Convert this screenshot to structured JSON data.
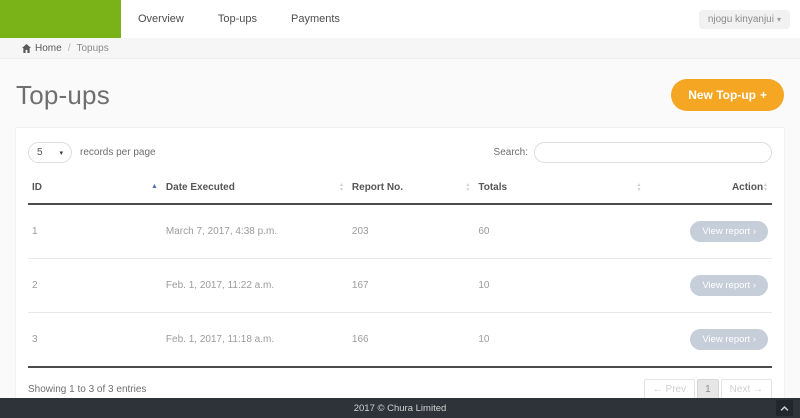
{
  "navbar": {
    "items": [
      {
        "label": "Overview"
      },
      {
        "label": "Top-ups"
      },
      {
        "label": "Payments"
      }
    ],
    "user_menu": {
      "label": "njogu kinyanjui"
    }
  },
  "breadcrumb": {
    "home": "Home",
    "separator": "/",
    "current": "Topups"
  },
  "page": {
    "title": "Top-ups",
    "new_topup": {
      "label": "New Top-up",
      "icon": "+"
    }
  },
  "controls": {
    "page_size": "5",
    "records_label": "records per page",
    "search_label": "Search:",
    "search_value": ""
  },
  "table": {
    "columns": [
      {
        "label": "ID"
      },
      {
        "label": "Date Executed"
      },
      {
        "label": "Report No."
      },
      {
        "label": "Totals"
      },
      {
        "label": "Action"
      }
    ],
    "rows": [
      {
        "id": "1",
        "date": "March 7, 2017, 4:38 p.m.",
        "report_no": "203",
        "totals": "60",
        "action": "View report ›"
      },
      {
        "id": "2",
        "date": "Feb. 1, 2017, 11:22 a.m.",
        "report_no": "167",
        "totals": "10",
        "action": "View report ›"
      },
      {
        "id": "3",
        "date": "Feb. 1, 2017, 11:18 a.m.",
        "report_no": "166",
        "totals": "10",
        "action": "View report ›"
      }
    ],
    "summary": "Showing 1 to 3 of 3 entries",
    "pagination": {
      "prev": "← Prev",
      "current": "1",
      "next": "Next →"
    }
  },
  "footer": {
    "text": "2017 © Chura Limited"
  },
  "icons": {
    "caret_down": "▾",
    "sort_asc": "▲",
    "sort_up": "▲",
    "sort_down": "▼"
  },
  "colors": {
    "brand_green": "#7ab317",
    "accent_orange": "#f5a623",
    "view_button_gray": "#c5ced9",
    "sort_active_blue": "#5570b8",
    "footer_dark": "#2e333a"
  }
}
